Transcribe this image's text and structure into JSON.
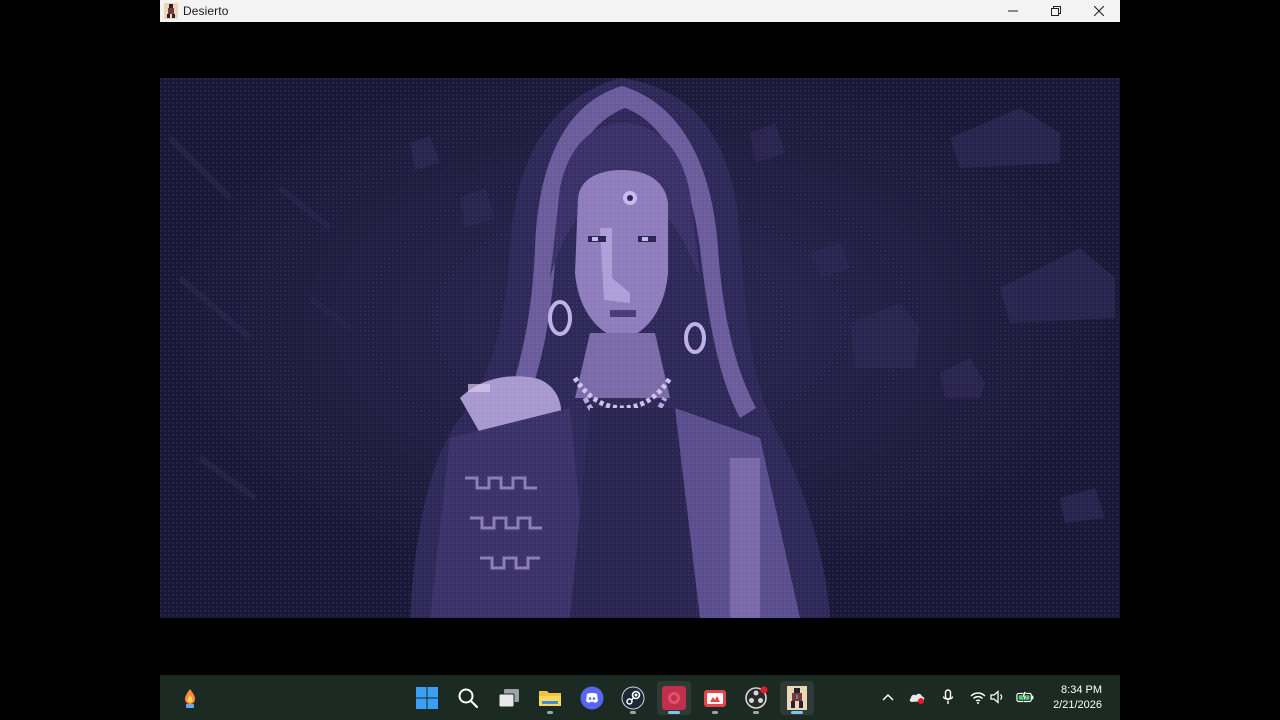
{
  "window": {
    "title": "Desierto",
    "icon": "desierto-app-icon",
    "controls": [
      "minimize-icon",
      "restore-icon",
      "close-icon"
    ]
  },
  "game": {
    "scene": "pixel-art-portrait",
    "palette": {
      "background": "#1a1838",
      "dark": "#2a2550",
      "mid": "#5a4e8e",
      "light": "#9a8ac8",
      "highlight": "#d8c8f0"
    }
  },
  "taskbar": {
    "widgets_icon": "weather-widget-icon",
    "pinned": [
      {
        "name": "start-icon",
        "active": false
      },
      {
        "name": "search-icon",
        "active": false
      },
      {
        "name": "task-view-icon",
        "active": false
      },
      {
        "name": "file-explorer-icon",
        "active": false,
        "running": true
      },
      {
        "name": "discord-icon",
        "active": false
      },
      {
        "name": "steam-icon",
        "active": false,
        "running": true
      },
      {
        "name": "recorder-app-icon",
        "active": true,
        "running": true
      },
      {
        "name": "game-app-icon",
        "active": false,
        "running": true
      },
      {
        "name": "obs-icon",
        "active": false,
        "running": true
      },
      {
        "name": "desierto-taskbar-icon",
        "active": true,
        "running": true
      }
    ],
    "tray": [
      "chevron-up-icon",
      "cloud-sync-icon",
      "microphone-icon",
      "wifi-icon",
      "volume-icon",
      "battery-icon"
    ],
    "clock": {
      "time": "8:34 PM",
      "date": "2/21/2026"
    }
  }
}
